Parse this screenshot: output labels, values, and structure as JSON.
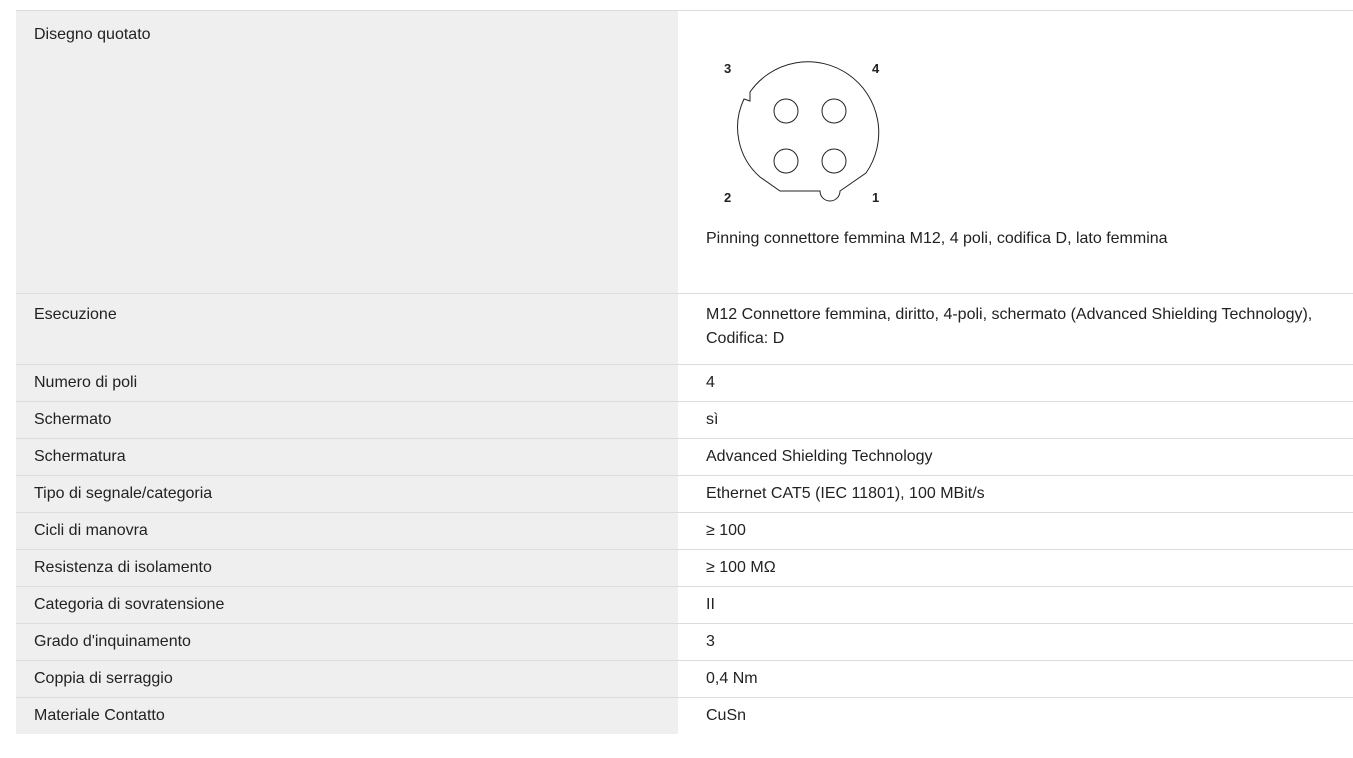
{
  "drawing": {
    "label": "Disegno quotato",
    "pins": [
      "3",
      "4",
      "2",
      "1"
    ],
    "caption": "Pinning connettore femmina M12, 4 poli, codifica D, lato femmina"
  },
  "rows": [
    {
      "label": "Esecuzione",
      "value": "M12 Connettore femmina, diritto, 4-poli, schermato (Advanced Shielding Technology), Codifica: D"
    },
    {
      "label": "Numero di poli",
      "value": "4"
    },
    {
      "label": "Schermato",
      "value": "sì"
    },
    {
      "label": "Schermatura",
      "value": "Advanced Shielding Technology"
    },
    {
      "label": "Tipo di segnale/categoria",
      "value": "Ethernet CAT5 (IEC 11801), 100 MBit/s"
    },
    {
      "label": "Cicli di manovra",
      "value": "≥ 100"
    },
    {
      "label": "Resistenza di isolamento",
      "value": "≥ 100 MΩ"
    },
    {
      "label": "Categoria di sovratensione",
      "value": "II"
    },
    {
      "label": "Grado d'inquinamento",
      "value": "3"
    },
    {
      "label": "Coppia di serraggio",
      "value": "0,4 Nm"
    },
    {
      "label": "Materiale Contatto",
      "value": "CuSn"
    }
  ]
}
